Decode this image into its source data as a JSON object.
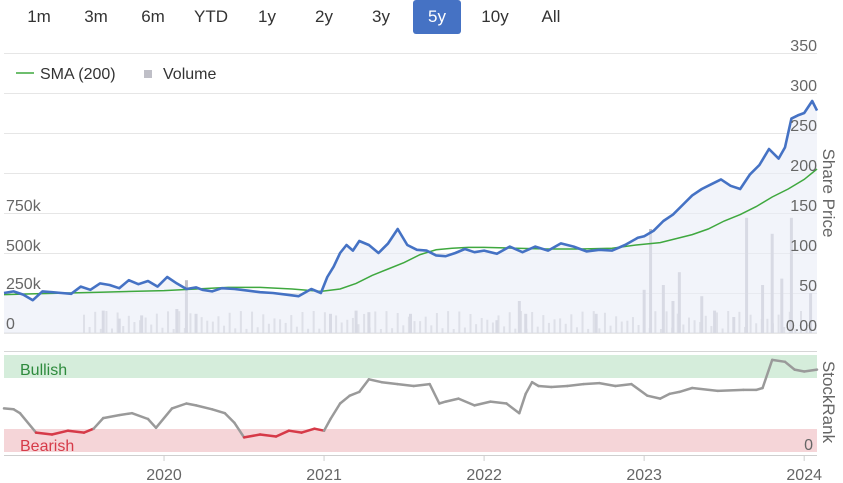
{
  "range_buttons": [
    "1m",
    "3m",
    "6m",
    "YTD",
    "1y",
    "2y",
    "3y",
    "5y",
    "10y",
    "All"
  ],
  "active_range": "5y",
  "colors": {
    "price": "#4572c4",
    "sma": "#3fa83f",
    "volume": "#bfbfc7",
    "bullish_band": "#d5eddb",
    "bearish_band": "#f5d5d8",
    "stockrank_neutral": "#9a9a9a",
    "stockrank_bearish": "#d63a48",
    "bullish_text": "#2e8b3d",
    "bearish_text": "#d63a48"
  },
  "chart_data": [
    {
      "type": "line",
      "legend": [
        "SMA (200)",
        "Volume"
      ],
      "y_right_label": "Share Price",
      "y_right_ticks": [
        "0.00",
        "50",
        "100",
        "150",
        "200",
        "250",
        "300",
        "350"
      ],
      "y_left_ticks": [
        "0",
        "250k",
        "500k",
        "750k"
      ],
      "x_ticks": [
        "2020",
        "2021",
        "2022",
        "2023",
        "2024"
      ],
      "ylim": [
        0,
        350
      ],
      "series": [
        {
          "name": "Price",
          "x": [
            2019.0,
            2019.06,
            2019.12,
            2019.18,
            2019.24,
            2019.3,
            2019.36,
            2019.42,
            2019.48,
            2019.54,
            2019.6,
            2019.66,
            2019.72,
            2019.78,
            2019.84,
            2019.9,
            2019.96,
            2020.02,
            2020.08,
            2020.14,
            2020.2,
            2020.24,
            2020.3,
            2020.36,
            2020.44,
            2020.52,
            2020.6,
            2020.68,
            2020.76,
            2020.84,
            2020.92,
            2020.98,
            2021.02,
            2021.06,
            2021.1,
            2021.14,
            2021.18,
            2021.22,
            2021.28,
            2021.34,
            2021.4,
            2021.46,
            2021.52,
            2021.58,
            2021.64,
            2021.7,
            2021.76,
            2021.82,
            2021.88,
            2021.94,
            2022.0,
            2022.08,
            2022.16,
            2022.24,
            2022.32,
            2022.4,
            2022.48,
            2022.56,
            2022.64,
            2022.72,
            2022.8,
            2022.88,
            2022.96,
            2023.0,
            2023.06,
            2023.12,
            2023.18,
            2023.24,
            2023.3,
            2023.36,
            2023.42,
            2023.48,
            2023.54,
            2023.6,
            2023.66,
            2023.72,
            2023.78,
            2023.84,
            2023.88,
            2023.92,
            2023.96,
            2024.0,
            2024.05,
            2024.08
          ],
          "values": [
            50,
            52,
            48,
            41,
            52,
            51,
            50,
            49,
            58,
            54,
            62,
            60,
            56,
            66,
            61,
            65,
            58,
            70,
            62,
            55,
            57,
            54,
            52,
            56,
            55,
            53,
            51,
            50,
            48,
            46,
            55,
            50,
            70,
            83,
            100,
            110,
            103,
            115,
            110,
            100,
            112,
            130,
            110,
            104,
            103,
            97,
            96,
            100,
            105,
            101,
            103,
            99,
            108,
            101,
            108,
            103,
            112,
            108,
            102,
            104,
            103,
            110,
            119,
            121,
            128,
            140,
            148,
            160,
            172,
            180,
            186,
            192,
            184,
            180,
            198,
            210,
            230,
            218,
            232,
            268,
            272,
            275,
            290,
            278
          ]
        },
        {
          "name": "SMA (200)",
          "x": [
            2019.0,
            2019.2,
            2019.4,
            2019.6,
            2019.8,
            2020.0,
            2020.2,
            2020.4,
            2020.6,
            2020.8,
            2020.98,
            2021.1,
            2021.2,
            2021.3,
            2021.4,
            2021.5,
            2021.6,
            2021.7,
            2021.8,
            2021.9,
            2022.0,
            2022.2,
            2022.4,
            2022.6,
            2022.8,
            2022.95,
            2023.1,
            2023.2,
            2023.3,
            2023.4,
            2023.5,
            2023.6,
            2023.7,
            2023.8,
            2023.9,
            2024.0,
            2024.08
          ],
          "values": [
            48,
            49,
            50,
            51,
            52,
            53,
            55,
            57,
            57,
            55,
            52,
            55,
            62,
            72,
            80,
            88,
            98,
            104,
            106,
            107,
            107,
            106,
            105,
            105,
            106,
            110,
            113,
            118,
            123,
            130,
            140,
            148,
            158,
            170,
            180,
            192,
            205
          ]
        },
        {
          "name": "Volume",
          "x": [
            2019.62,
            2019.72,
            2019.86,
            2020.08,
            2020.14,
            2020.2,
            2021.04,
            2021.2,
            2021.28,
            2021.54,
            2022.08,
            2022.22,
            2022.26,
            2022.7,
            2023.0,
            2023.04,
            2023.12,
            2023.18,
            2023.22,
            2023.36,
            2023.44,
            2023.56,
            2023.64,
            2023.74,
            2023.8,
            2023.86,
            2023.92,
            2024.04
          ],
          "values": [
            140000,
            90000,
            110000,
            150000,
            330000,
            120000,
            120000,
            140000,
            130000,
            120000,
            80000,
            200000,
            120000,
            120000,
            270000,
            650000,
            300000,
            200000,
            380000,
            230000,
            140000,
            100000,
            720000,
            300000,
            620000,
            340000,
            720000,
            250000
          ]
        }
      ]
    },
    {
      "type": "line",
      "y_right_label": "StockRank",
      "y_right_ticks": [
        "0"
      ],
      "band_labels": [
        "Bullish",
        "Bearish"
      ],
      "x_ticks": [
        "2020",
        "2021",
        "2022",
        "2023",
        "2024"
      ],
      "ylim": [
        0,
        100
      ],
      "series": [
        {
          "name": "StockRank",
          "x": [
            2019.0,
            2019.06,
            2019.1,
            2019.2,
            2019.3,
            2019.4,
            2019.5,
            2019.56,
            2019.62,
            2019.72,
            2019.8,
            2019.9,
            2019.95,
            2020.05,
            2020.14,
            2020.2,
            2020.3,
            2020.38,
            2020.44,
            2020.5,
            2020.6,
            2020.7,
            2020.78,
            2020.86,
            2020.94,
            2021.0,
            2021.04,
            2021.1,
            2021.16,
            2021.22,
            2021.28,
            2021.36,
            2021.46,
            2021.56,
            2021.66,
            2021.72,
            2021.76,
            2021.84,
            2021.94,
            2022.04,
            2022.14,
            2022.22,
            2022.26,
            2022.3,
            2022.34,
            2022.42,
            2022.52,
            2022.62,
            2022.72,
            2022.82,
            2022.92,
            2023.02,
            2023.1,
            2023.16,
            2023.22,
            2023.3,
            2023.46,
            2023.62,
            2023.7,
            2023.74,
            2023.8,
            2023.88,
            2023.94,
            2024.0,
            2024.08
          ],
          "values": [
            45,
            44,
            40,
            20,
            18,
            22,
            20,
            24,
            35,
            38,
            40,
            34,
            25,
            45,
            50,
            48,
            44,
            40,
            30,
            15,
            18,
            16,
            22,
            20,
            24,
            22,
            34,
            50,
            58,
            62,
            75,
            72,
            70,
            68,
            70,
            50,
            52,
            55,
            48,
            52,
            50,
            40,
            60,
            72,
            68,
            67,
            68,
            70,
            71,
            68,
            70,
            58,
            55,
            60,
            62,
            66,
            63,
            64,
            64,
            66,
            95,
            93,
            85,
            83,
            85
          ]
        }
      ]
    }
  ]
}
